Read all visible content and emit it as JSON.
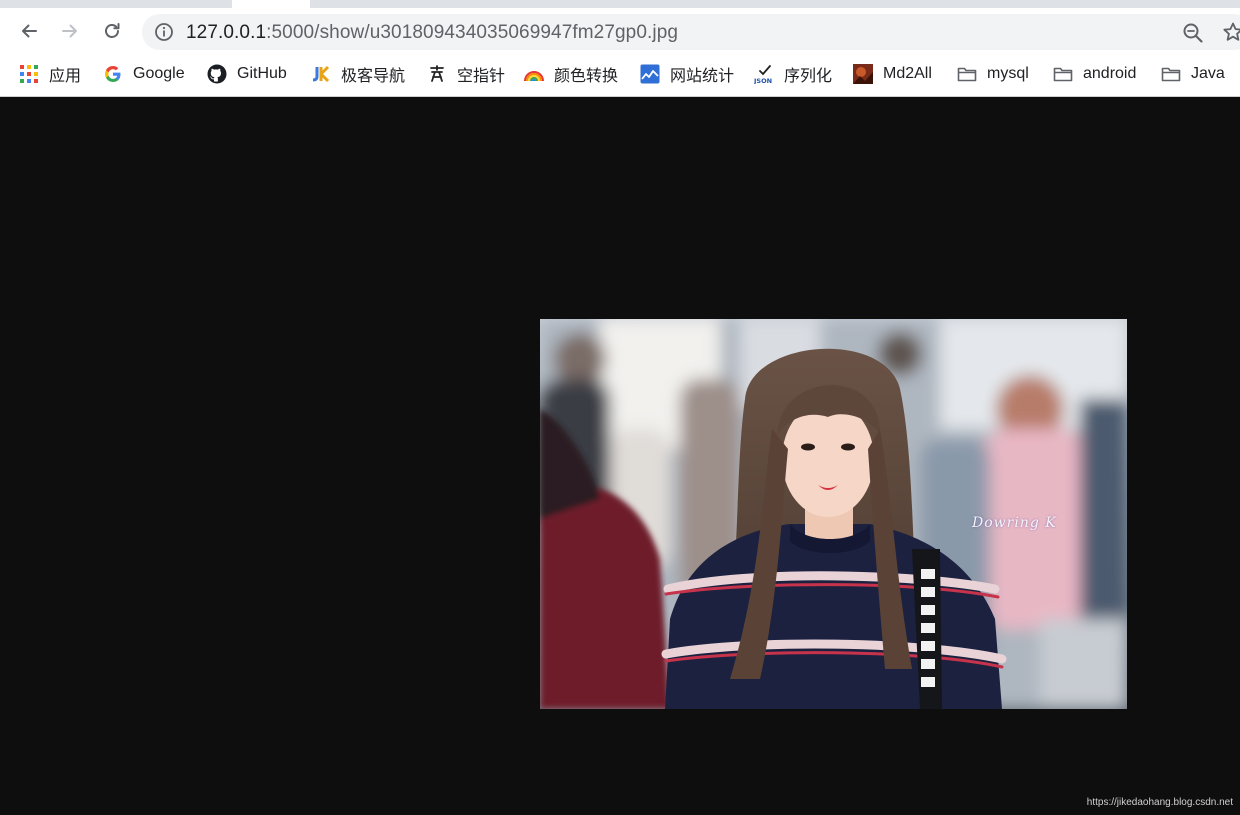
{
  "browser": {
    "url_host": "127.0.0.1",
    "url_path": ":5000/show/u301809434035069947fm27gp0.jpg",
    "toolbar_icons": [
      "back-arrow-icon",
      "forward-arrow-icon",
      "reload-icon",
      "info-icon",
      "zoom-icon",
      "star-icon"
    ]
  },
  "bookmarks": [
    {
      "label": "应用",
      "icon": "apps-grid-icon"
    },
    {
      "label": "Google",
      "icon": "google-icon"
    },
    {
      "label": "GitHub",
      "icon": "github-icon"
    },
    {
      "label": "极客导航",
      "icon": "jk-logo-icon"
    },
    {
      "label": "空指针",
      "icon": "pointer-logo-icon"
    },
    {
      "label": "颜色转换",
      "icon": "rainbow-icon"
    },
    {
      "label": "网站统计",
      "icon": "stats-chart-icon"
    },
    {
      "label": "序列化",
      "icon": "json-icon"
    },
    {
      "label": "Md2All",
      "icon": "md2all-avatar-icon"
    },
    {
      "label": "mysql",
      "icon": "folder-icon"
    },
    {
      "label": "android",
      "icon": "folder-icon"
    },
    {
      "label": "Java",
      "icon": "folder-icon"
    }
  ],
  "content": {
    "photo_watermark": "Dowring K",
    "footer_watermark": "https://jikedaohang.blog.csdn.net"
  },
  "colors": {
    "page_background": "#0e0e0e",
    "toolbar_background": "#ffffff",
    "omnibox_background": "#f1f3f4"
  }
}
